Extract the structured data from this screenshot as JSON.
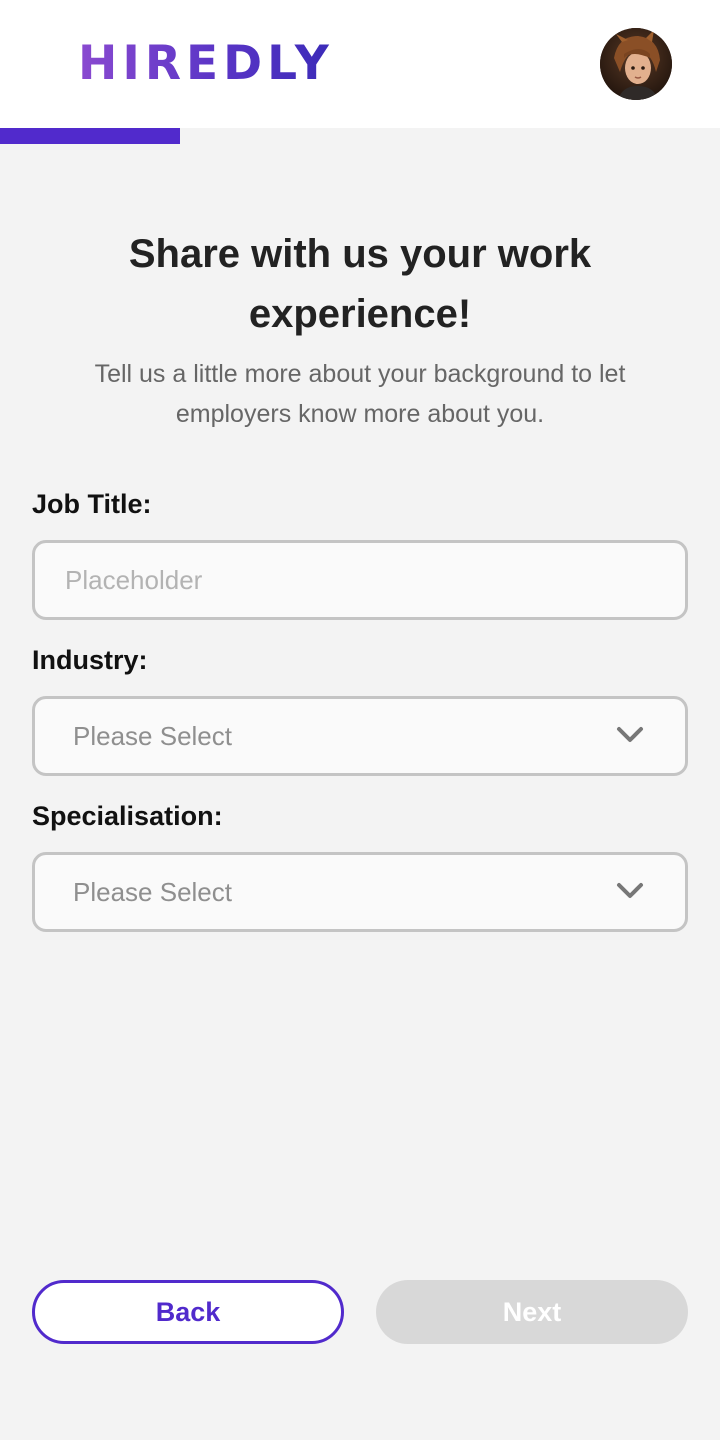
{
  "header": {
    "logo_text": "HIREDLY",
    "avatar_alt": "User avatar"
  },
  "progress": {
    "fraction": 0.25
  },
  "intro": {
    "title": "Share with us your work experience!",
    "subtitle": "Tell us a little more about your background to let employers know more about you."
  },
  "form": {
    "job_title": {
      "label": "Job Title:",
      "placeholder": "Placeholder",
      "value": ""
    },
    "industry": {
      "label": "Industry:",
      "value": "Please Select"
    },
    "specialisation": {
      "label": "Specialisation:",
      "value": "Please Select"
    }
  },
  "actions": {
    "back_label": "Back",
    "next_label": "Next"
  },
  "colors": {
    "brand": "#512acc",
    "background": "#f3f3f3",
    "disabled_button": "#d8d8d8"
  }
}
